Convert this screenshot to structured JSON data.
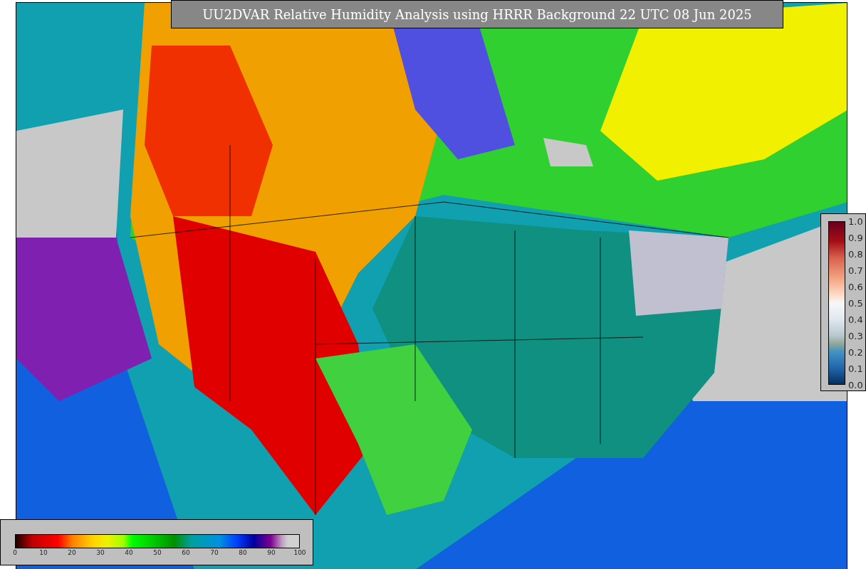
{
  "title": "UU2DVAR Relative Humidity Analysis using HRRR Background 22 UTC 08 Jun 2025",
  "humidity_colorbar": {
    "ticks": [
      "0",
      "10",
      "20",
      "30",
      "40",
      "50",
      "60",
      "70",
      "80",
      "90",
      "100"
    ]
  },
  "probability_colorbar": {
    "ticks": [
      "1.0",
      "0.9",
      "0.8",
      "0.7",
      "0.6",
      "0.5",
      "0.4",
      "0.3",
      "0.2",
      "0.1",
      "0.0"
    ]
  }
}
